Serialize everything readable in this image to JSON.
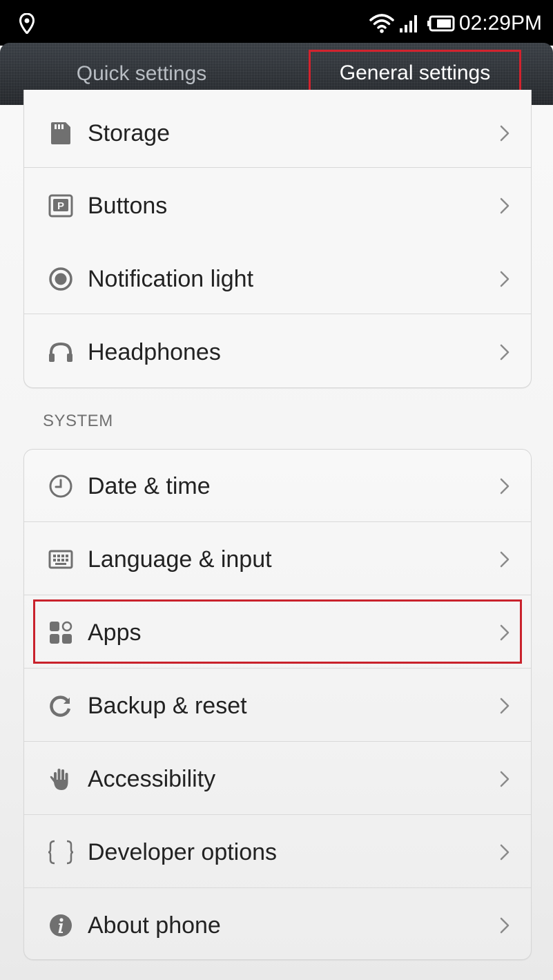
{
  "status_bar": {
    "time": "02:29PM"
  },
  "tabs": {
    "quick": "Quick settings",
    "general": "General settings"
  },
  "section_system": "SYSTEM",
  "device_items": [
    {
      "label": "Storage",
      "icon": "sd-card-icon"
    },
    {
      "label": "Buttons",
      "icon": "button-p-icon"
    },
    {
      "label": "Notification light",
      "icon": "notification-light-icon"
    },
    {
      "label": "Headphones",
      "icon": "headphones-icon"
    }
  ],
  "system_items": [
    {
      "label": "Date & time",
      "icon": "clock-icon"
    },
    {
      "label": "Language & input",
      "icon": "keyboard-icon"
    },
    {
      "label": "Apps",
      "icon": "apps-grid-icon"
    },
    {
      "label": "Backup & reset",
      "icon": "backup-reset-icon"
    },
    {
      "label": "Accessibility",
      "icon": "hand-icon"
    },
    {
      "label": "Developer options",
      "icon": "braces-icon"
    },
    {
      "label": "About phone",
      "icon": "info-icon"
    }
  ],
  "colors": {
    "highlight": "#c9222c",
    "header": "#2f3338",
    "icon": "#707070"
  }
}
